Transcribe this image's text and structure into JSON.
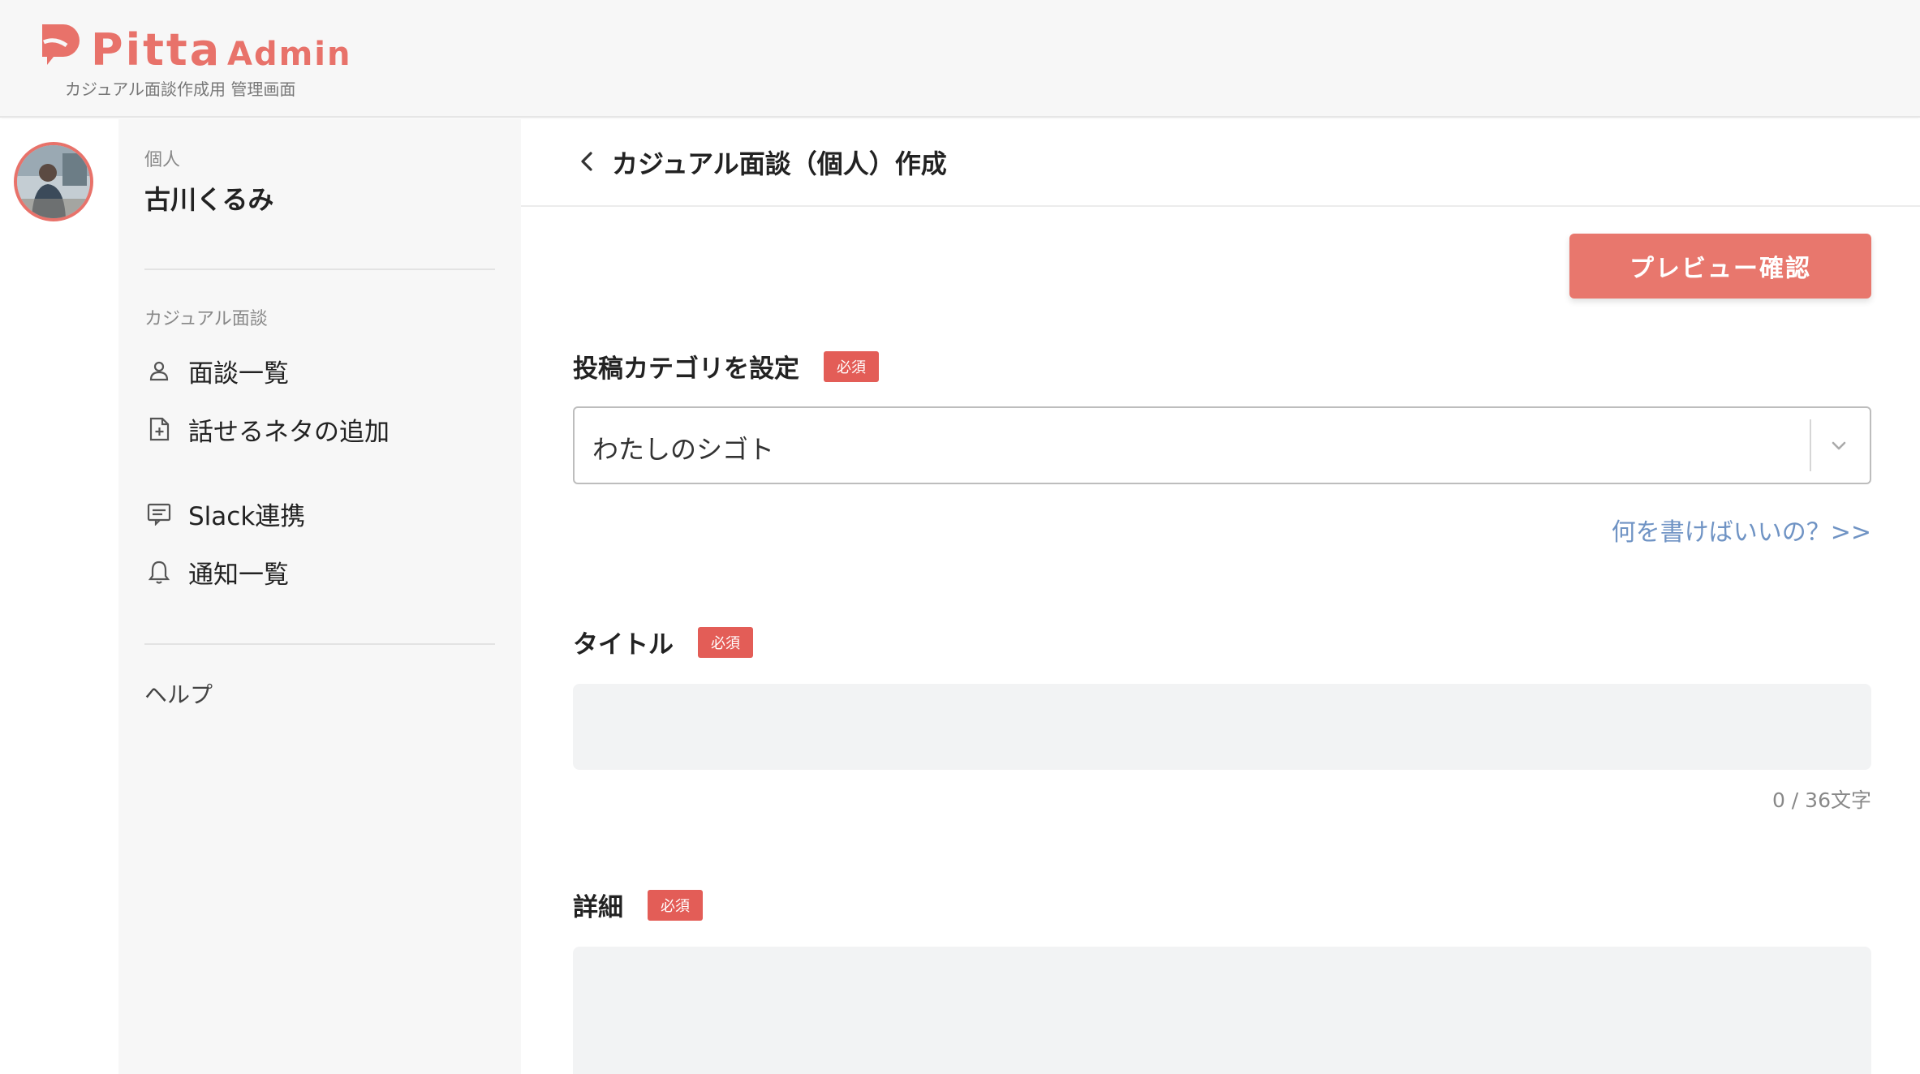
{
  "header": {
    "logo_text": "Pitta",
    "logo_admin": "Admin",
    "subtitle": "カジュアル面談作成用 管理画面",
    "brand_color": "#e8726a"
  },
  "sidebar": {
    "user_type": "個人",
    "user_name": "古川くるみ",
    "section_label": "カジュアル面談",
    "items": [
      {
        "label": "面談一覧",
        "icon": "person-icon"
      },
      {
        "label": "話せるネタの追加",
        "icon": "file-plus-icon"
      },
      {
        "label": "Slack連携",
        "icon": "slack-message-icon"
      },
      {
        "label": "通知一覧",
        "icon": "bell-icon"
      }
    ],
    "help_label": "ヘルプ"
  },
  "main": {
    "page_title": "カジュアル面談（個人）作成",
    "preview_button": "プレビュー確認",
    "category": {
      "label": "投稿カテゴリを設定",
      "required": "必須",
      "selected": "わたしのシゴト"
    },
    "hint_link": "何を書けばいいの？>>",
    "title_field": {
      "label": "タイトル",
      "required": "必須",
      "value": "",
      "counter": "0 / 36文字"
    },
    "detail_field": {
      "label": "詳細",
      "required": "必須",
      "value": ""
    }
  },
  "colors": {
    "accent": "#e8776d",
    "required_badge": "#e35d57",
    "link": "#6f93c4",
    "input_bg": "#f2f3f4"
  }
}
